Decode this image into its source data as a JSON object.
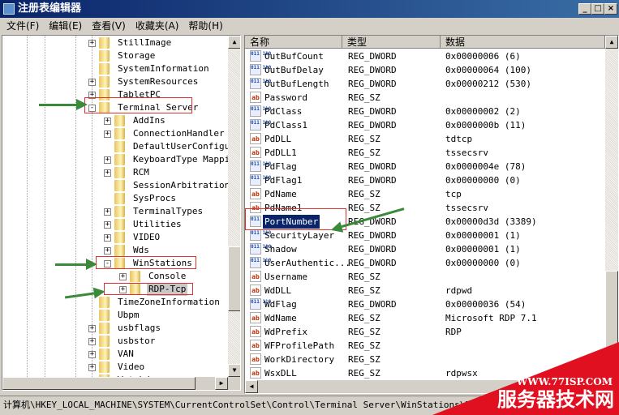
{
  "window": {
    "title": "注册表编辑器",
    "buttons": {
      "minimize": "_",
      "maximize": "□",
      "close": "×"
    }
  },
  "menu": [
    "文件(F)",
    "编辑(E)",
    "查看(V)",
    "收藏夹(A)",
    "帮助(H)"
  ],
  "tree": [
    {
      "label": "StillImage",
      "level": 1,
      "expander": "+"
    },
    {
      "label": "Storage",
      "level": 1,
      "expander": ""
    },
    {
      "label": "SystemInformation",
      "level": 1,
      "expander": ""
    },
    {
      "label": "SystemResources",
      "level": 1,
      "expander": "+"
    },
    {
      "label": "TabletPC",
      "level": 1,
      "expander": "+"
    },
    {
      "label": "Terminal Server",
      "level": 1,
      "expander": "-"
    },
    {
      "label": "AddIns",
      "level": 2,
      "expander": "+"
    },
    {
      "label": "ConnectionHandler",
      "level": 2,
      "expander": "+"
    },
    {
      "label": "DefaultUserConfiguration",
      "level": 2,
      "expander": ""
    },
    {
      "label": "KeyboardType Mapping",
      "level": 2,
      "expander": "+"
    },
    {
      "label": "RCM",
      "level": 2,
      "expander": "+"
    },
    {
      "label": "SessionArbitrationHelper",
      "level": 2,
      "expander": ""
    },
    {
      "label": "SysProcs",
      "level": 2,
      "expander": ""
    },
    {
      "label": "TerminalTypes",
      "level": 2,
      "expander": "+"
    },
    {
      "label": "Utilities",
      "level": 2,
      "expander": "+"
    },
    {
      "label": "VIDEO",
      "level": 2,
      "expander": "+"
    },
    {
      "label": "Wds",
      "level": 2,
      "expander": "+"
    },
    {
      "label": "WinStations",
      "level": 2,
      "expander": "-"
    },
    {
      "label": "Console",
      "level": 3,
      "expander": "+"
    },
    {
      "label": "RDP-Tcp",
      "level": 3,
      "expander": "+",
      "selected": true
    },
    {
      "label": "TimeZoneInformation",
      "level": 1,
      "expander": ""
    },
    {
      "label": "Ubpm",
      "level": 1,
      "expander": ""
    },
    {
      "label": "usbflags",
      "level": 1,
      "expander": "+"
    },
    {
      "label": "usbstor",
      "level": 1,
      "expander": "+"
    },
    {
      "label": "VAN",
      "level": 1,
      "expander": "+"
    },
    {
      "label": "Video",
      "level": 1,
      "expander": "+"
    },
    {
      "label": "Watchdog",
      "level": 1,
      "expander": "+"
    }
  ],
  "columns": [
    "名称",
    "类型",
    "数据"
  ],
  "values": [
    {
      "name": "OutBufCount",
      "type": "REG_DWORD",
      "data": "0x00000006 (6)"
    },
    {
      "name": "OutBufDelay",
      "type": "REG_DWORD",
      "data": "0x00000064 (100)"
    },
    {
      "name": "OutBufLength",
      "type": "REG_DWORD",
      "data": "0x00000212 (530)"
    },
    {
      "name": "Password",
      "type": "REG_SZ",
      "data": ""
    },
    {
      "name": "PdClass",
      "type": "REG_DWORD",
      "data": "0x00000002 (2)"
    },
    {
      "name": "PdClass1",
      "type": "REG_DWORD",
      "data": "0x0000000b (11)"
    },
    {
      "name": "PdDLL",
      "type": "REG_SZ",
      "data": "tdtcp"
    },
    {
      "name": "PdDLL1",
      "type": "REG_SZ",
      "data": "tssecsrv"
    },
    {
      "name": "PdFlag",
      "type": "REG_DWORD",
      "data": "0x0000004e (78)"
    },
    {
      "name": "PdFlag1",
      "type": "REG_DWORD",
      "data": "0x00000000 (0)"
    },
    {
      "name": "PdName",
      "type": "REG_SZ",
      "data": "tcp"
    },
    {
      "name": "PdName1",
      "type": "REG_SZ",
      "data": "tssecsrv"
    },
    {
      "name": "PortNumber",
      "type": "REG_DWORD",
      "data": "0x00000d3d (3389)",
      "selected": true
    },
    {
      "name": "SecurityLayer",
      "type": "REG_DWORD",
      "data": "0x00000001 (1)"
    },
    {
      "name": "Shadow",
      "type": "REG_DWORD",
      "data": "0x00000001 (1)"
    },
    {
      "name": "UserAuthentic...",
      "type": "REG_DWORD",
      "data": "0x00000000 (0)"
    },
    {
      "name": "Username",
      "type": "REG_SZ",
      "data": ""
    },
    {
      "name": "WdDLL",
      "type": "REG_SZ",
      "data": "rdpwd"
    },
    {
      "name": "WdFlag",
      "type": "REG_DWORD",
      "data": "0x00000036 (54)"
    },
    {
      "name": "WdName",
      "type": "REG_SZ",
      "data": "Microsoft RDP 7.1"
    },
    {
      "name": "WdPrefix",
      "type": "REG_SZ",
      "data": "RDP"
    },
    {
      "name": "WFProfilePath",
      "type": "REG_SZ",
      "data": ""
    },
    {
      "name": "WorkDirectory",
      "type": "REG_SZ",
      "data": ""
    },
    {
      "name": "WsxDLL",
      "type": "REG_SZ",
      "data": "rdpwsx"
    }
  ],
  "icons": {
    "REG_SZ": "ab",
    "REG_DWORD": "011\n110"
  },
  "status": "计算机\\HKEY_LOCAL_MACHINE\\SYSTEM\\CurrentControlSet\\Control\\Terminal Server\\WinStations\\RDP-Tcp",
  "watermark": {
    "url": "WWW.77ISP.COM",
    "name": "服务器技术网"
  },
  "colors": {
    "title": "#0a246a",
    "selection": "#0a246a",
    "highlight_box": "#e03030",
    "arrow": "#3a8a3a",
    "watermark": "#e01020"
  }
}
